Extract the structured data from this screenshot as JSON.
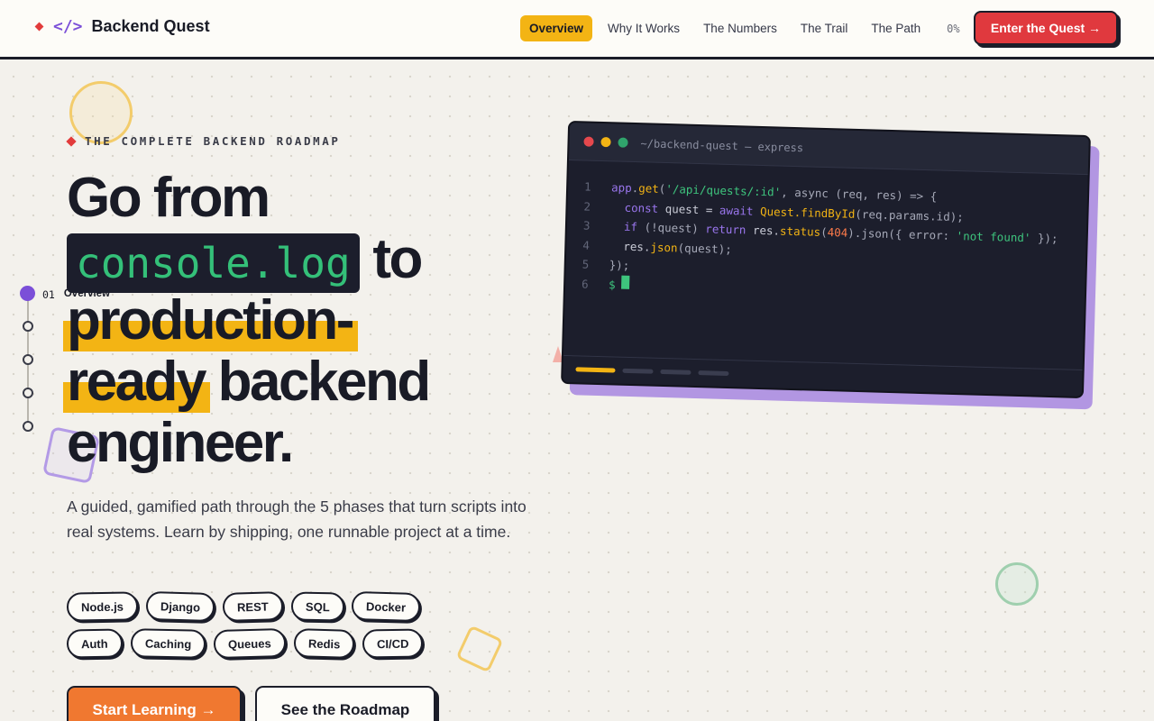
{
  "nav": {
    "brand_code": "</>",
    "brand_name": "Backend Quest",
    "links": [
      "Overview",
      "Why It Works",
      "The Numbers",
      "The Trail",
      "The Path"
    ],
    "active_link": "Overview",
    "progress": "0%",
    "cta": "Enter the Quest →"
  },
  "timeline": {
    "active_number": "01",
    "active_label": "Overview",
    "total_steps": 5
  },
  "hero": {
    "eyebrow": "THE COMPLETE BACKEND ROADMAP",
    "headline": {
      "line1": "Go from",
      "code": "console.log",
      "line2_suffix": " to",
      "line3": "production-",
      "line4_mark": "ready",
      "line4_suffix": " backend",
      "line5": "engineer."
    },
    "subtitle": "A guided, gamified path through the 5 phases that turn scripts into real systems. Learn by shipping, one runnable project at a time.",
    "tags": [
      "Node.js",
      "Django",
      "REST",
      "SQL",
      "Docker",
      "Auth",
      "Caching",
      "Queues",
      "Redis",
      "CI/CD"
    ],
    "primary_button": "Start Learning →",
    "secondary_button": "See the Roadmap"
  },
  "terminal": {
    "title": "~/backend-quest — express",
    "lines": [
      {
        "n": "1",
        "parts": [
          [
            "kw",
            "app"
          ],
          [
            "dim",
            "."
          ],
          [
            "fn",
            "get"
          ],
          [
            "dim",
            "("
          ],
          [
            "str",
            "'/api/quests/:id'"
          ],
          [
            "dim",
            ", async (req, res) => {"
          ]
        ]
      },
      {
        "n": "2",
        "parts": [
          [
            "dim",
            "  "
          ],
          [
            "kw",
            "const"
          ],
          [
            "txt",
            " quest = "
          ],
          [
            "kw",
            "await"
          ],
          [
            "txt",
            " "
          ],
          [
            "cls",
            "Quest.findById"
          ],
          [
            "dim",
            "(req.params.id);"
          ]
        ]
      },
      {
        "n": "3",
        "parts": [
          [
            "dim",
            "  "
          ],
          [
            "kw",
            "if"
          ],
          [
            "dim",
            " (!quest) "
          ],
          [
            "kw",
            "return"
          ],
          [
            "txt",
            " res."
          ],
          [
            "fn",
            "status"
          ],
          [
            "dim",
            "("
          ],
          [
            "num",
            "404"
          ],
          [
            "dim",
            ").json({ error: "
          ],
          [
            "str",
            "'not found'"
          ],
          [
            "dim",
            " });"
          ]
        ]
      },
      {
        "n": "4",
        "parts": [
          [
            "txt",
            "  res."
          ],
          [
            "fn",
            "json"
          ],
          [
            "dim",
            "(quest);"
          ]
        ]
      },
      {
        "n": "5",
        "parts": [
          [
            "dim",
            "});"
          ]
        ]
      }
    ],
    "prompt_line": "6",
    "prompt": "$",
    "progress_segments": 4,
    "progress_active": 1
  },
  "colors": {
    "accent_yellow": "#f3b414",
    "accent_red": "#e0393e",
    "accent_orange": "#f07830",
    "accent_purple": "#7b4fd8",
    "code_green": "#34c079",
    "ink": "#191b26"
  }
}
